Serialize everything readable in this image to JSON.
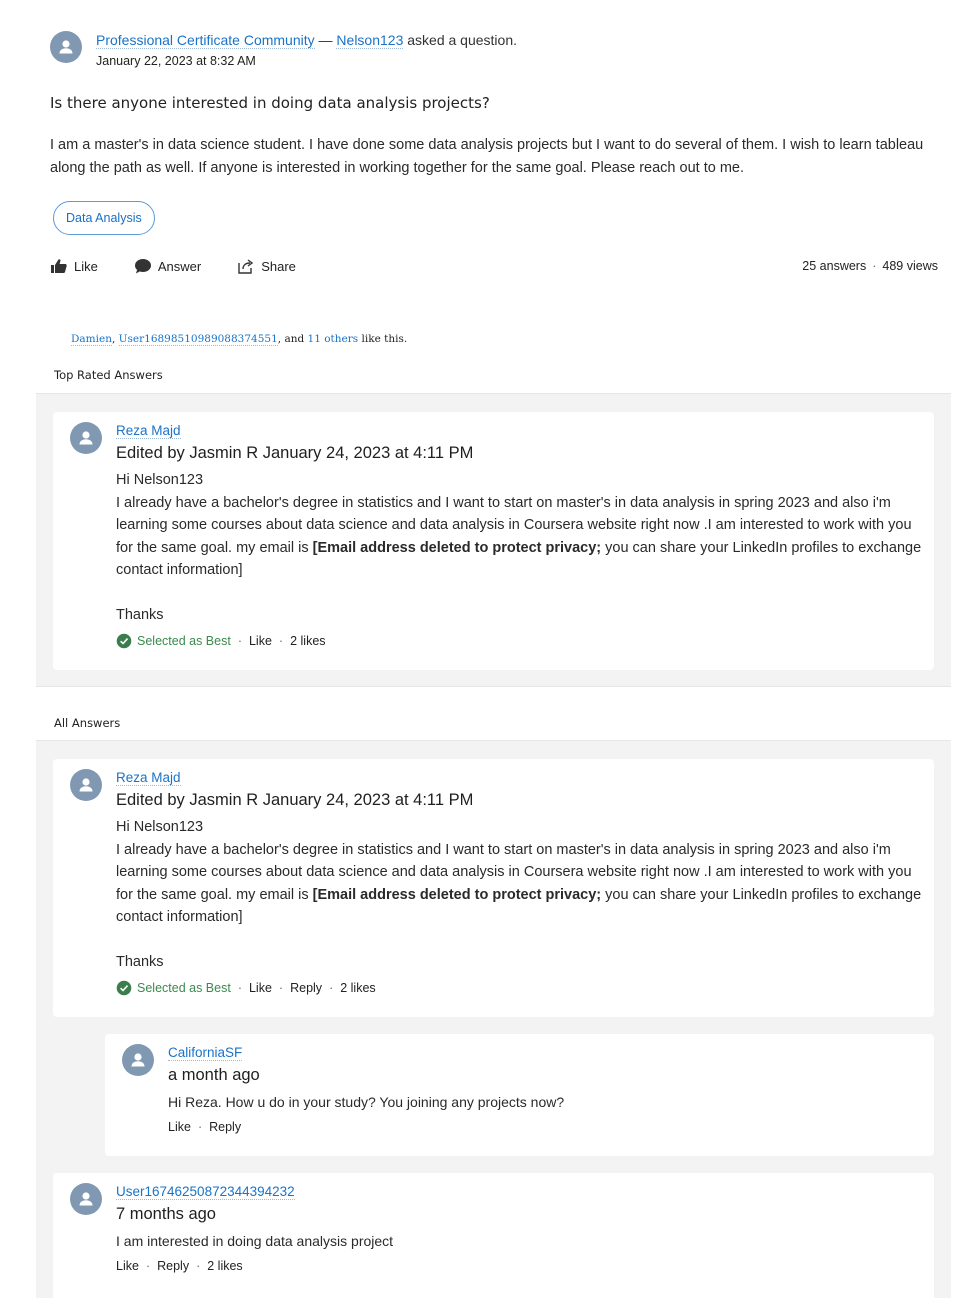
{
  "question": {
    "community": "Professional Certificate Community",
    "separator": " — ",
    "author": "Nelson123",
    "action_text": " asked a question.",
    "date": "January 22, 2023 at 8:32 AM",
    "title": "Is there anyone interested in doing data analysis projects?",
    "body": "I am a master's in data science student. I have done some data analysis projects but I want to do several of them. I wish to learn tableau along the path as well. If anyone is interested in working together for the same goal. Please reach out to me.",
    "tag": "Data Analysis",
    "actions": {
      "like": "Like",
      "answer": "Answer",
      "share": "Share"
    },
    "answers_count": "25 answers",
    "views_count": "489 views",
    "likers": {
      "user1": "Damien",
      "user2": "User16898510989088374551",
      "connector": ", and ",
      "others": "11 others",
      "suffix": " like this."
    }
  },
  "sections": {
    "top_rated": "Top Rated Answers",
    "all_answers": "All Answers"
  },
  "answer": {
    "author": "Reza Majd",
    "edited": "Edited by Jasmin R January 24, 2023 at 4:11 PM",
    "greeting": "Hi Nelson123",
    "body_pre": "I already have a bachelor's degree in statistics and I want to start on master's in data analysis in spring 2023 and also i'm learning some courses about data science and data analysis in Coursera website right now .I am interested to work with you for the same goal. my email is ",
    "body_bold": "[Email address deleted to protect privacy;",
    "body_post": " you can share your LinkedIn profiles to exchange contact information]",
    "signoff": "Thanks",
    "best_label": "Selected as Best",
    "like_label": "Like",
    "reply_label": "Reply",
    "likes_count": "2 likes"
  },
  "reply": {
    "author": "CaliforniaSF",
    "time": "a month ago",
    "body": "Hi Reza. How u do in your study? You joining any projects now?",
    "like_label": "Like",
    "reply_label": "Reply"
  },
  "answer2": {
    "author": "User16746250872344394232",
    "time": "7 months ago",
    "body": "I am interested in doing data analysis project",
    "like_label": "Like",
    "reply_label": "Reply",
    "likes_count": "2 likes"
  },
  "colors": {
    "link": "#1a73c7",
    "best": "#3b8a4e",
    "panel": "#f3f3f3",
    "avatar": "#8098b2"
  }
}
